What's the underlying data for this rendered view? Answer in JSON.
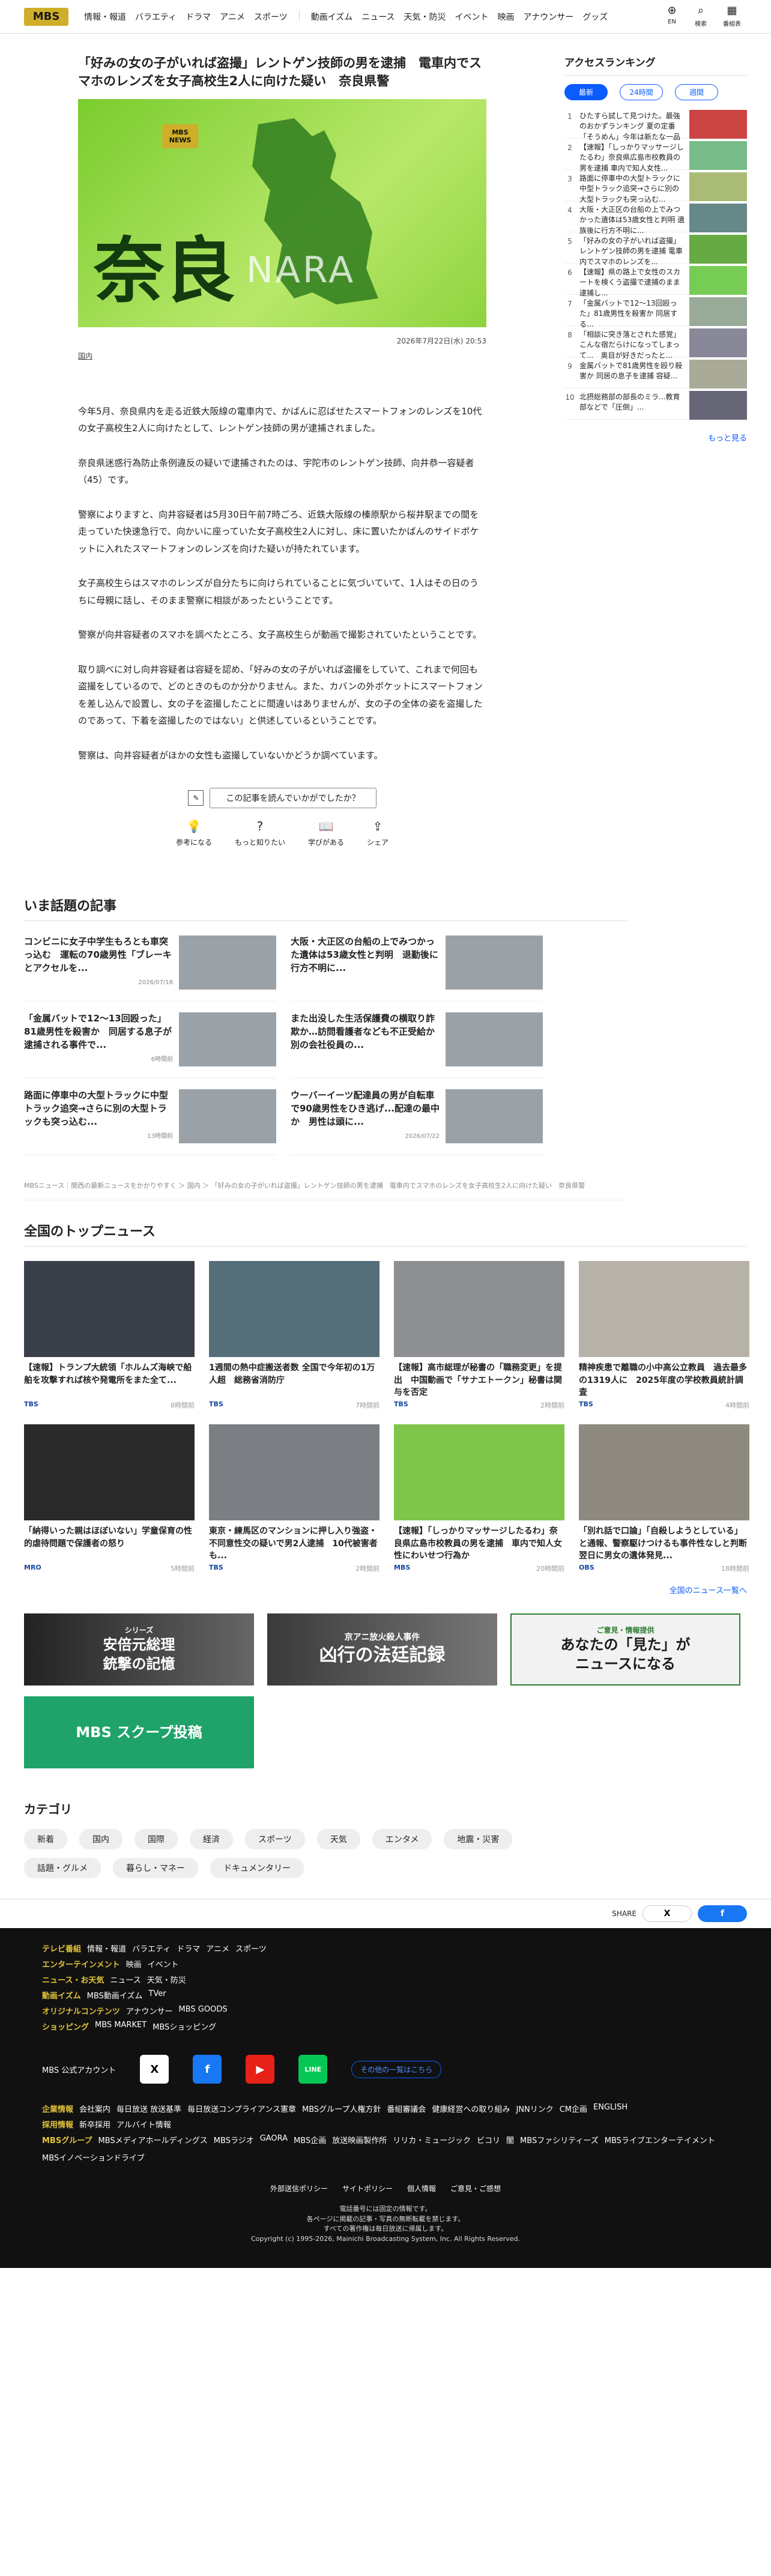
{
  "nav": {
    "logo": "MBS",
    "items": [
      "情報・報道",
      "バラエティ",
      "ドラマ",
      "アニメ",
      "スポーツ",
      "動画イズム",
      "ニュース",
      "天気・防災",
      "イベント",
      "映画",
      "アナウンサー",
      "グッズ"
    ],
    "tools": [
      "EN",
      "検索",
      "番組表"
    ]
  },
  "article": {
    "title": "「好みの女の子がいれば盗撮」レントゲン技師の男を逮捕　電車内でスマホのレンズを女子高校生2人に向けた疑い　奈良県警",
    "hero_kanji": "奈良",
    "hero_en": "NARA",
    "hero_logo": "MBS",
    "hero_logo_sub": "NEWS",
    "date": "2026年7月22日(水) 20:53",
    "category": "国内",
    "paragraphs": [
      "今年5月、奈良県内を走る近鉄大阪線の電車内で、かばんに忍ばせたスマートフォンのレンズを10代の女子高校生2人に向けたとして、レントゲン技師の男が逮捕されました。",
      "奈良県迷惑行為防止条例違反の疑いで逮捕されたのは、宇陀市のレントゲン技師、向井恭一容疑者（45）です。",
      "警察によりますと、向井容疑者は5月30日午前7時ごろ、近鉄大阪線の榛原駅から桜井駅までの間を走っていた快速急行で、向かいに座っていた女子高校生2人に対し、床に置いたかばんのサイドポケットに入れたスマートフォンのレンズを向けた疑いが持たれています。",
      "女子高校生らはスマホのレンズが自分たちに向けられていることに気づいていて、1人はその日のうちに母親に話し、そのまま警察に相談があったということです。",
      "警察が向井容疑者のスマホを調べたところ、女子高校生らが動画で撮影されていたということです。",
      "取り調べに対し向井容疑者は容疑を認め、「好みの女の子がいれば盗撮をしていて、これまで何回も盗撮をしているので、どのときのものか分かりません。また、カバンの外ポケットにスマートフォンを差し込んで設置し、女の子を盗撮したことに間違いはありませんが、女の子の全体の姿を盗撮したのであって、下着を盗撮したのではない」と供述しているということです。",
      "警察は、向井容疑者がほかの女性も盗撮していないかどうか調べています。"
    ]
  },
  "feedback": {
    "question": "この記事を読んでいかがでしたか？",
    "buttons": [
      "参考になる",
      "もっと知りたい",
      "学びがある",
      "シェア"
    ]
  },
  "ranking": {
    "title": "アクセスランキング",
    "tabs": [
      "最新",
      "24時間",
      "週間"
    ],
    "more": "もっと見る",
    "items": [
      "ひたすら試して見つけた。最強のおかずランキング 夏の定番「そうめん」今年は新たな一品が見つかる？ご飯...",
      "【速報】「しっかりマッサージしたるわ」奈良県広島市校教員の男を逮捕 車内で知人女性...",
      "路面に停車中の大型トラックに中型トラック追突→さらに別の大型トラックも突っ込む...",
      "大阪・大正区の台船の上でみつかった遺体は53歳女性と判明 遺族後に行方不明に...",
      "「好みの女の子がいれば盗撮」レントゲン技師の男を逮捕 電車内でスマホのレンズを...",
      "【速報】県の路上で女性のスカートを検くう盗撮で逮捕のまま逮捕し...",
      "「金属バットで12～13回殴った」81歳男性を殺害か 同居する...",
      "「相談に突き落とされた感覚」こんな宿だらけになってしまって...　奥目が好きだったと...",
      "金属バットで81歳男性を殴り殺害か 同居の息子を逮捕 容疑...",
      "北摂総務部の部長のミラ...教育部などで「圧倒」..."
    ]
  },
  "topics": {
    "title": "いま話題の記事",
    "items": [
      {
        "t": "コンビニに女子中学生もろとも車突っ込む　運転の70歳男性「ブレーキとアクセルを...",
        "d": "2026/07/18"
      },
      {
        "t": "大阪・大正区の台船の上でみつかった遺体は53歳女性と判明　退勤後に行方不明に...",
        "d": ""
      },
      {
        "t": "「金属バットで12～13回殴った」81歳男性を殺害か　同居する息子が逮捕される事件で...",
        "d": "6時間前"
      },
      {
        "t": "また出没した生活保護費の横取り詐欺か…訪問看護者なども不正受給か　別の会社役員の...",
        "d": ""
      },
      {
        "t": "路面に停車中の大型トラックに中型トラック追突→さらに別の大型トラックも突っ込む...",
        "d": "13時間前"
      },
      {
        "t": "ウーバーイーツ配達員の男が自転車で90歳男性をひき逃げ...配達の最中か　男性は頭に...",
        "d": "2026/07/22"
      }
    ]
  },
  "breadcrumb": "MBSニュース｜関西の最新ニュースをかかりやすく ＞ 国内 ＞ 「好みの女の子がいれば盗撮」レントゲン技師の男を逮捕　電車内でスマホのレンズを女子高校生2人に向けた疑い　奈良県警",
  "national": {
    "title": "全国のトップニュース",
    "more": "全国のニュース一覧へ",
    "items": [
      {
        "t": "【速報】トランプ大統領「ホルムズ海峡で船舶を攻撃すれば核や発電所をまた全て...",
        "s": "TBS",
        "m": "8時間前"
      },
      {
        "t": "1週間の熱中症搬送者数 全国で今年初の1万人超　総務省消防庁",
        "s": "TBS",
        "m": "7時間前"
      },
      {
        "t": "【速報】高市総理が秘書の「職務変更」を提出　中国動画で「サナエトークン」秘書は関与を否定",
        "s": "TBS",
        "m": "2時間前"
      },
      {
        "t": "精神疾患で離職の小中高公立教員　過去最多の1319人に　2025年度の学校教員統計調査",
        "s": "TBS",
        "m": "4時間前"
      },
      {
        "t": "「納得いった親はほぼいない」学童保育の性的虐待問題で保護者の怒り",
        "s": "MRO",
        "m": "5時間前"
      },
      {
        "t": "東京・練馬区のマンションに押し入り強盗・不同意性交の疑いで男2人逮捕　10代被害者も...",
        "s": "TBS",
        "m": "2時間前"
      },
      {
        "t": "【速報】「しっかりマッサージしたるわ」奈良県広島市校教員の男を逮捕　車内で知人女性にわいせつ行為か",
        "s": "MBS",
        "m": "20時間前"
      },
      {
        "t": "「別れ話で口論」「自殺しようとしている」と通報、警察駆けつけるも事件性なしと判断　翌日に男女の遺体発見...",
        "s": "OBS",
        "m": "18時間前"
      }
    ]
  },
  "banners": [
    {
      "a": "シリーズ",
      "b": "安倍元総理\n銃撃の記憶"
    },
    {
      "a": "京アニ放火殺人事件",
      "b": "凶行の法廷記録"
    },
    {
      "a": "ご意見・情報提供",
      "b": "あなたの「見た」が\nニュースになる"
    },
    {
      "a": "MBS",
      "b": "スクープ投稿"
    }
  ],
  "categories": {
    "title": "カテゴリ",
    "items": [
      "新着",
      "国内",
      "国際",
      "経済",
      "スポーツ",
      "天気",
      "エンタメ",
      "地震・災害",
      "話題・グルメ",
      "暮らし・マネー",
      "ドキュメンタリー"
    ]
  },
  "share": {
    "label": "SHARE",
    "x": "X",
    "fb": "f"
  },
  "footer": {
    "rows": [
      {
        "h": "テレビ番組",
        "i": [
          "情報・報道",
          "バラエティ",
          "ドラマ",
          "アニメ",
          "スポーツ"
        ]
      },
      {
        "h": "エンターテインメント",
        "i": [
          "映画",
          "イベント"
        ]
      },
      {
        "h": "ニュース・お天気",
        "i": [
          "ニュース",
          "天気・防災"
        ]
      }
    ],
    "rows2": [
      {
        "h": "動画イズム",
        "i": [
          "MBS動画イズム",
          "TVer"
        ]
      },
      {
        "h": "オリジナルコンテンツ",
        "i": [
          "アナウンサー",
          "MBS GOODS"
        ]
      },
      {
        "h": "ショッピング",
        "i": [
          "MBS MARKET",
          "MBSショッピング"
        ]
      }
    ],
    "account": "MBS 公式アカウント",
    "more_accounts": "その他の一覧はこちら",
    "corp": [
      {
        "h": "企業情報",
        "i": [
          "会社案内",
          "毎日放送 放送基準",
          "毎日放送コンプライアンス憲章",
          "MBSグループ人権方針",
          "番組審議会",
          "健康経営への取り組み",
          "JNNリンク",
          "CM企画",
          "ENGLISH"
        ]
      },
      {
        "h": "採用情報",
        "i": [
          "新卒採用",
          "アルバイト情報"
        ]
      },
      {
        "h": "MBSグループ",
        "i": [
          "MBSメディアホールディングス",
          "MBSラジオ",
          "GAORA",
          "MBS企画",
          "放送映画製作所",
          "リリカ・ミュージック",
          "ビコリ",
          "闇",
          "MBSファシリティーズ",
          "MBSライブエンターテイメント",
          "MBSイノベーションドライブ"
        ]
      }
    ],
    "bottom": [
      "外部送信ポリシー",
      "サイトポリシー",
      "個人情報",
      "ご意見・ご感想"
    ],
    "copy": [
      "電話番号には固定の情報です。",
      "各ページに掲載の記事・写真の無断転載を禁じます。",
      "すべての著作権は毎日放送に帰属します。",
      "Copyright (c) 1995-2026, Mainichi Broadcasting System, Inc. All Rights Reserved."
    ]
  }
}
